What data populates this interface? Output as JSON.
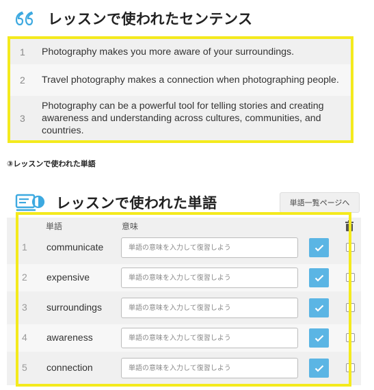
{
  "sentences_section": {
    "title": "レッスンで使われたセンテンス",
    "rows": [
      {
        "num": "1",
        "text": "Photography makes you more aware of your surroundings."
      },
      {
        "num": "2",
        "text": "Travel photography makes a connection when photographing people."
      },
      {
        "num": "3",
        "text": "Photography can be a powerful tool for telling stories and creating awareness and understanding across cultures, communities, and countries."
      }
    ]
  },
  "sub_label": "③レッスンで使われた単語",
  "words_section": {
    "title": "レッスンで使われた単語",
    "list_button": "単語一覧ページへ",
    "header_word": "単語",
    "header_meaning": "意味",
    "input_placeholder": "単語の意味を入力して復習しよう",
    "rows": [
      {
        "num": "1",
        "word": "communicate"
      },
      {
        "num": "2",
        "word": "expensive"
      },
      {
        "num": "3",
        "word": "surroundings"
      },
      {
        "num": "4",
        "word": "awareness"
      },
      {
        "num": "5",
        "word": "connection"
      }
    ]
  },
  "colors": {
    "highlight_frame": "#f4ea1d",
    "accent": "#5bb5e4",
    "row_bg": "#f0f0f0"
  },
  "icons": [
    "quote-icon",
    "vocabulary-card-icon",
    "trash-icon",
    "checkmark-icon"
  ]
}
